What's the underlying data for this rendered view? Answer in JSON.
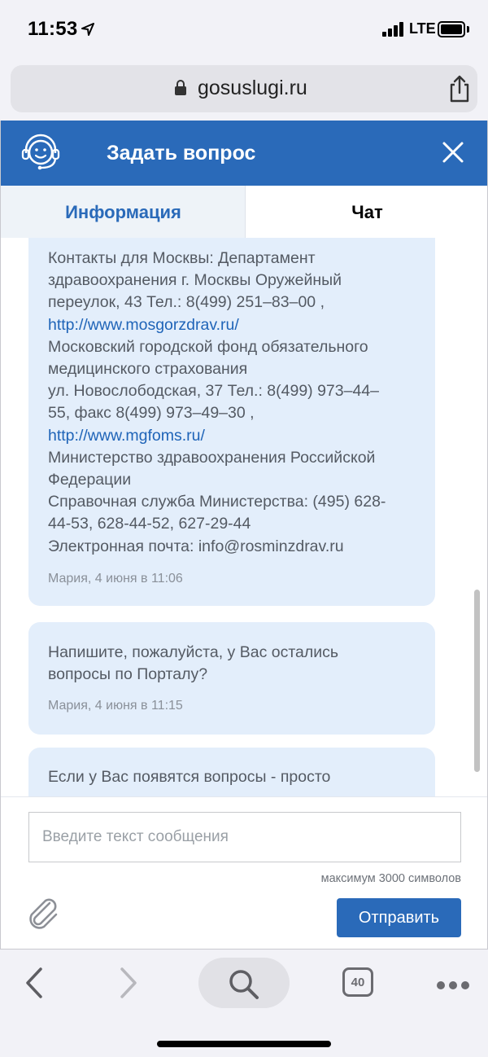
{
  "status_bar": {
    "time": "11:53",
    "network": "LTE"
  },
  "browser": {
    "url": "gosuslugi.ru",
    "tab_count": "40"
  },
  "header": {
    "title": "Задать вопрос"
  },
  "tabs": [
    {
      "label": "Информация",
      "active": false
    },
    {
      "label": "Чат",
      "active": true
    }
  ],
  "messages": [
    {
      "lines": [
        "Контакты для Москвы: Департамент",
        "здравоохранения г. Москвы Оружейный",
        "переулок, 43 Тел.: 8(499) 251–83–00 ,",
        "http://www.mosgorzdrav.ru/",
        "Московский городской фонд обязательного",
        "медицинского страхования",
        "ул. Новослободская, 37 Тел.: 8(499) 973–44–",
        "55, факс 8(499) 973–49–30 ,",
        "http://www.mgfoms.ru/",
        "Министерство здравоохранения Российской",
        "Федерации",
        "Справочная служба Министерства: (495) 628-",
        "44-53, 628-44-52, 627-29-44",
        "Электронная почта: info@rosminzdrav.ru"
      ],
      "meta": "Мария, 4 июня в 11:06"
    },
    {
      "lines": [
        "Напишите, пожалуйста, у Вас остались",
        "вопросы по Порталу?"
      ],
      "meta": "Мария, 4 июня в 11:15"
    },
    {
      "lines": [
        "Если у Вас появятся вопросы - просто"
      ],
      "meta": ""
    }
  ],
  "composer": {
    "placeholder": "Введите текст сообщения",
    "max_chars_note": "максимум 3000 символов",
    "send_label": "Отправить"
  },
  "colors": {
    "brand_blue": "#2a6ab9",
    "bubble_bg": "#e3eefb",
    "link": "#1f64b8"
  }
}
